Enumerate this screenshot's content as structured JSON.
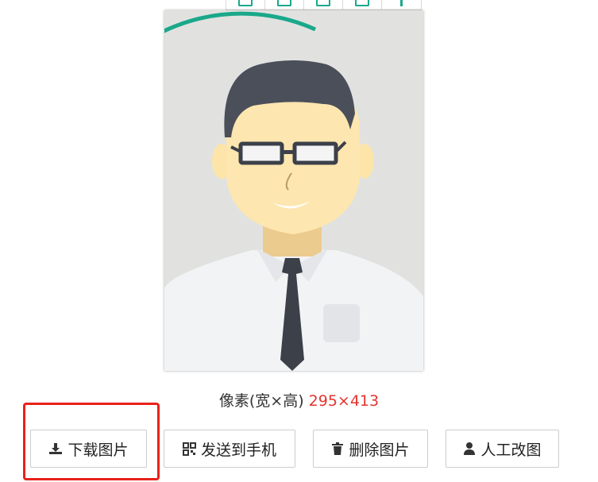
{
  "toolbar": {
    "icons": [
      "crop-icon",
      "compare-icon",
      "background-icon",
      "resize-icon",
      "download-arrow-icon"
    ]
  },
  "photo": {
    "subject": "illustrated man avatar",
    "background_color": "#e1e2e0",
    "accent_arc_color": "#1aa88a"
  },
  "pixel_info": {
    "label": "像素(宽×高)",
    "value": "295×413"
  },
  "actions": {
    "download": "下载图片",
    "send_to_phone": "发送到手机",
    "delete": "删除图片",
    "manual_edit": "人工改图"
  },
  "colors": {
    "highlight": "#e8221b",
    "pixel_value": "#e2362e"
  }
}
